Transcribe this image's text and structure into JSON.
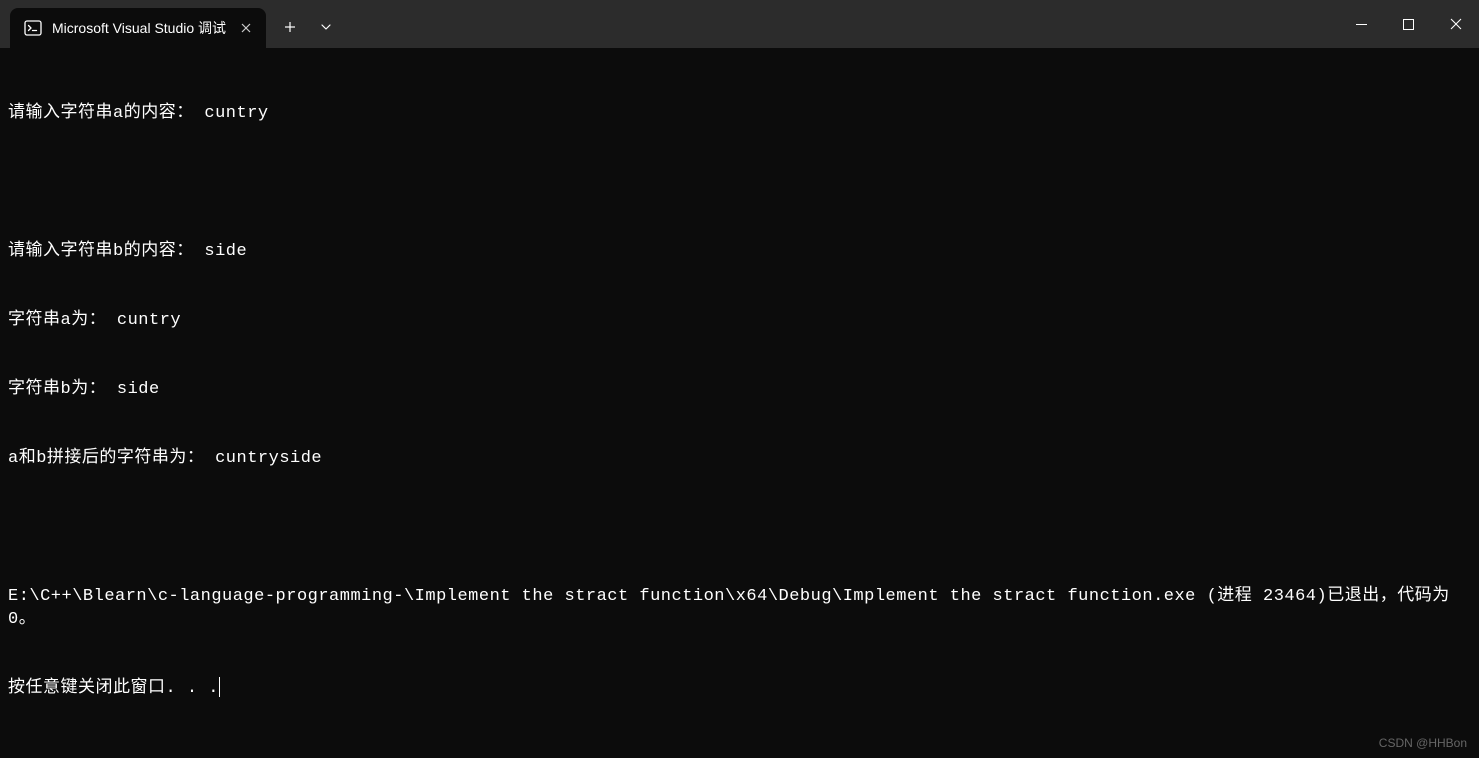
{
  "titlebar": {
    "tab_title": "Microsoft Visual Studio 调试",
    "new_tab_label": "+",
    "dropdown_label": "⌄"
  },
  "terminal": {
    "lines": [
      "请输入字符串a的内容： cuntry",
      "",
      "请输入字符串b的内容： side",
      "字符串a为： cuntry",
      "字符串b为： side",
      "a和b拼接后的字符串为： cuntryside",
      "",
      "E:\\C++\\Blearn\\c-language-programming-\\Implement the stract function\\x64\\Debug\\Implement the stract function.exe (进程 23464)已退出，代码为 0。",
      "按任意键关闭此窗口. . ."
    ]
  },
  "watermark": "CSDN @HHBon"
}
